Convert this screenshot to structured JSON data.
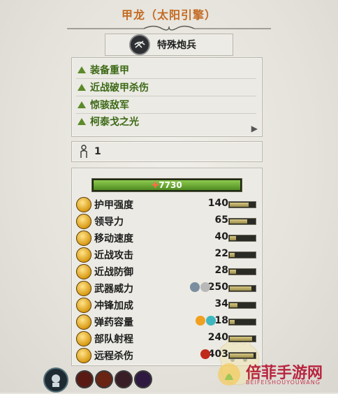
{
  "unit": {
    "title": "甲龙（太阳引擎）",
    "type_label": "特殊炮兵",
    "type_icon": "artillery-icon"
  },
  "abilities": [
    {
      "label": "装备重甲",
      "icon": "green-triangle-icon"
    },
    {
      "label": "近战破甲杀伤",
      "icon": "green-triangle-icon"
    },
    {
      "label": "惊骇敌军",
      "icon": "green-triangle-icon"
    },
    {
      "label": "柯泰戈之光",
      "icon": "green-triangle-icon"
    }
  ],
  "members": {
    "count": "1",
    "icon": "person-icon"
  },
  "health": {
    "value": "7730",
    "fraction": 1.0,
    "icon": "health-plus-icon"
  },
  "stats": [
    {
      "name": "护甲强度",
      "value": "140",
      "bar": 0.75,
      "icon": "armor-icon"
    },
    {
      "name": "领导力",
      "value": "65",
      "bar": 0.7,
      "icon": "leadership-icon"
    },
    {
      "name": "移动速度",
      "value": "40",
      "bar": 0.25,
      "icon": "speed-icon"
    },
    {
      "name": "近战攻击",
      "value": "22",
      "bar": 0.2,
      "icon": "melee-attack-icon"
    },
    {
      "name": "近战防御",
      "value": "28",
      "bar": 0.25,
      "icon": "melee-defence-icon"
    },
    {
      "name": "武器威力",
      "value": "250",
      "bar": 0.85,
      "icon": "weapon-strength-icon",
      "mods": [
        "bonus-vs-large-icon",
        "armour-piercing-icon"
      ]
    },
    {
      "name": "冲锋加成",
      "value": "34",
      "bar": 0.3,
      "icon": "charge-icon"
    },
    {
      "name": "弹药容量",
      "value": "18",
      "bar": 0.2,
      "icon": "ammunition-icon",
      "mods": [
        "fire-damage-icon",
        "magical-attack-icon"
      ]
    },
    {
      "name": "部队射程",
      "value": "240",
      "bar": 0.9,
      "icon": "range-icon"
    },
    {
      "name": "远程杀伤",
      "value": "403",
      "bar": 0.95,
      "icon": "missile-damage-icon",
      "mods": [
        "explosive-icon"
      ]
    }
  ],
  "bottom_icons": [
    "unit-card-icon",
    "red-skull-icon",
    "red-archway-icon",
    "pink-skull-icon",
    "purple-skull-icon"
  ],
  "watermark": {
    "text": "倍菲手游网",
    "sub": "BEIFEISHOUYOUWANG"
  },
  "colors": {
    "title": "#c46a22",
    "ability": "#3d6a16",
    "health": "#6ab03a",
    "watermark": "#b8253f"
  }
}
